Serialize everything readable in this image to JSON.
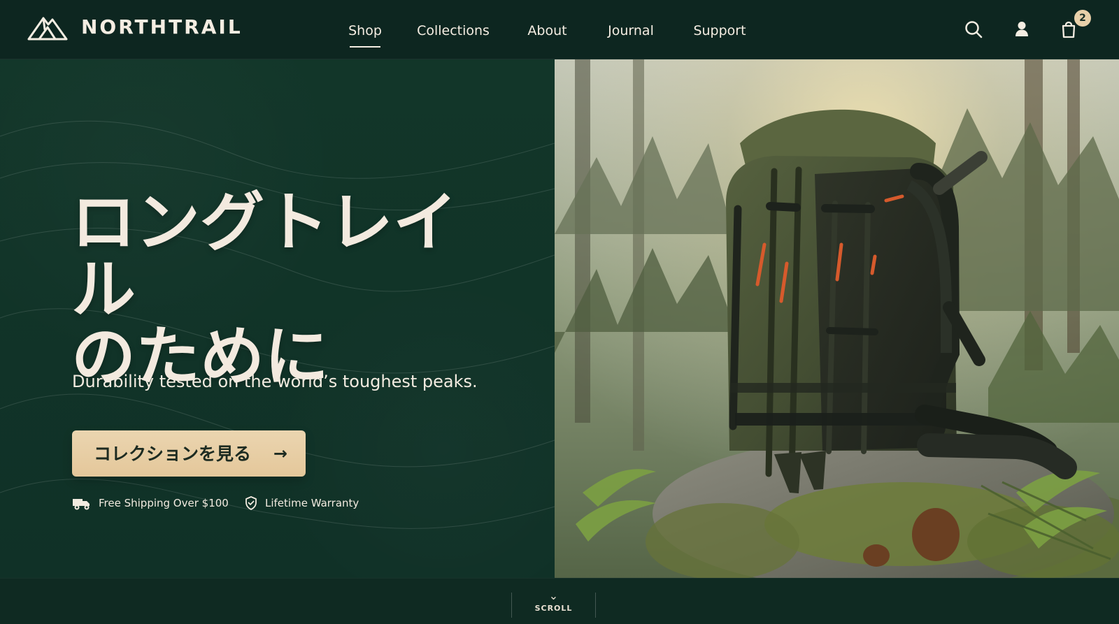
{
  "brand": {
    "name": "NORTHTRAIL",
    "logo_icon": "mountain-logo-icon",
    "colors": {
      "header_bg": "#0d2620",
      "hero_bg": "#123629",
      "accent": "#e8d0a9",
      "text": "#f4ede2"
    }
  },
  "nav": {
    "items": [
      {
        "label": "Shop",
        "active": true
      },
      {
        "label": "Collections",
        "active": false
      },
      {
        "label": "About",
        "active": false
      },
      {
        "label": "Journal",
        "active": false
      },
      {
        "label": "Support",
        "active": false
      }
    ]
  },
  "header_icons": {
    "search_icon": "search-icon",
    "account_icon": "user-icon",
    "cart_icon": "shopping-bag-icon",
    "cart_count": "2"
  },
  "hero": {
    "headline_lines": [
      "ロングトレイ",
      "ル",
      "のために"
    ],
    "subheadline": "Durability tested on the world’s toughest peaks.",
    "cta": {
      "label": "コレクションを見る",
      "arrow": "→"
    },
    "perks": [
      {
        "icon": "truck-icon",
        "label": "Free Shipping Over $100"
      },
      {
        "icon": "shield-check-icon",
        "label": "Lifetime Warranty"
      }
    ]
  },
  "scroll": {
    "label": "SCROLL",
    "icon": "chevron-down-icon"
  }
}
